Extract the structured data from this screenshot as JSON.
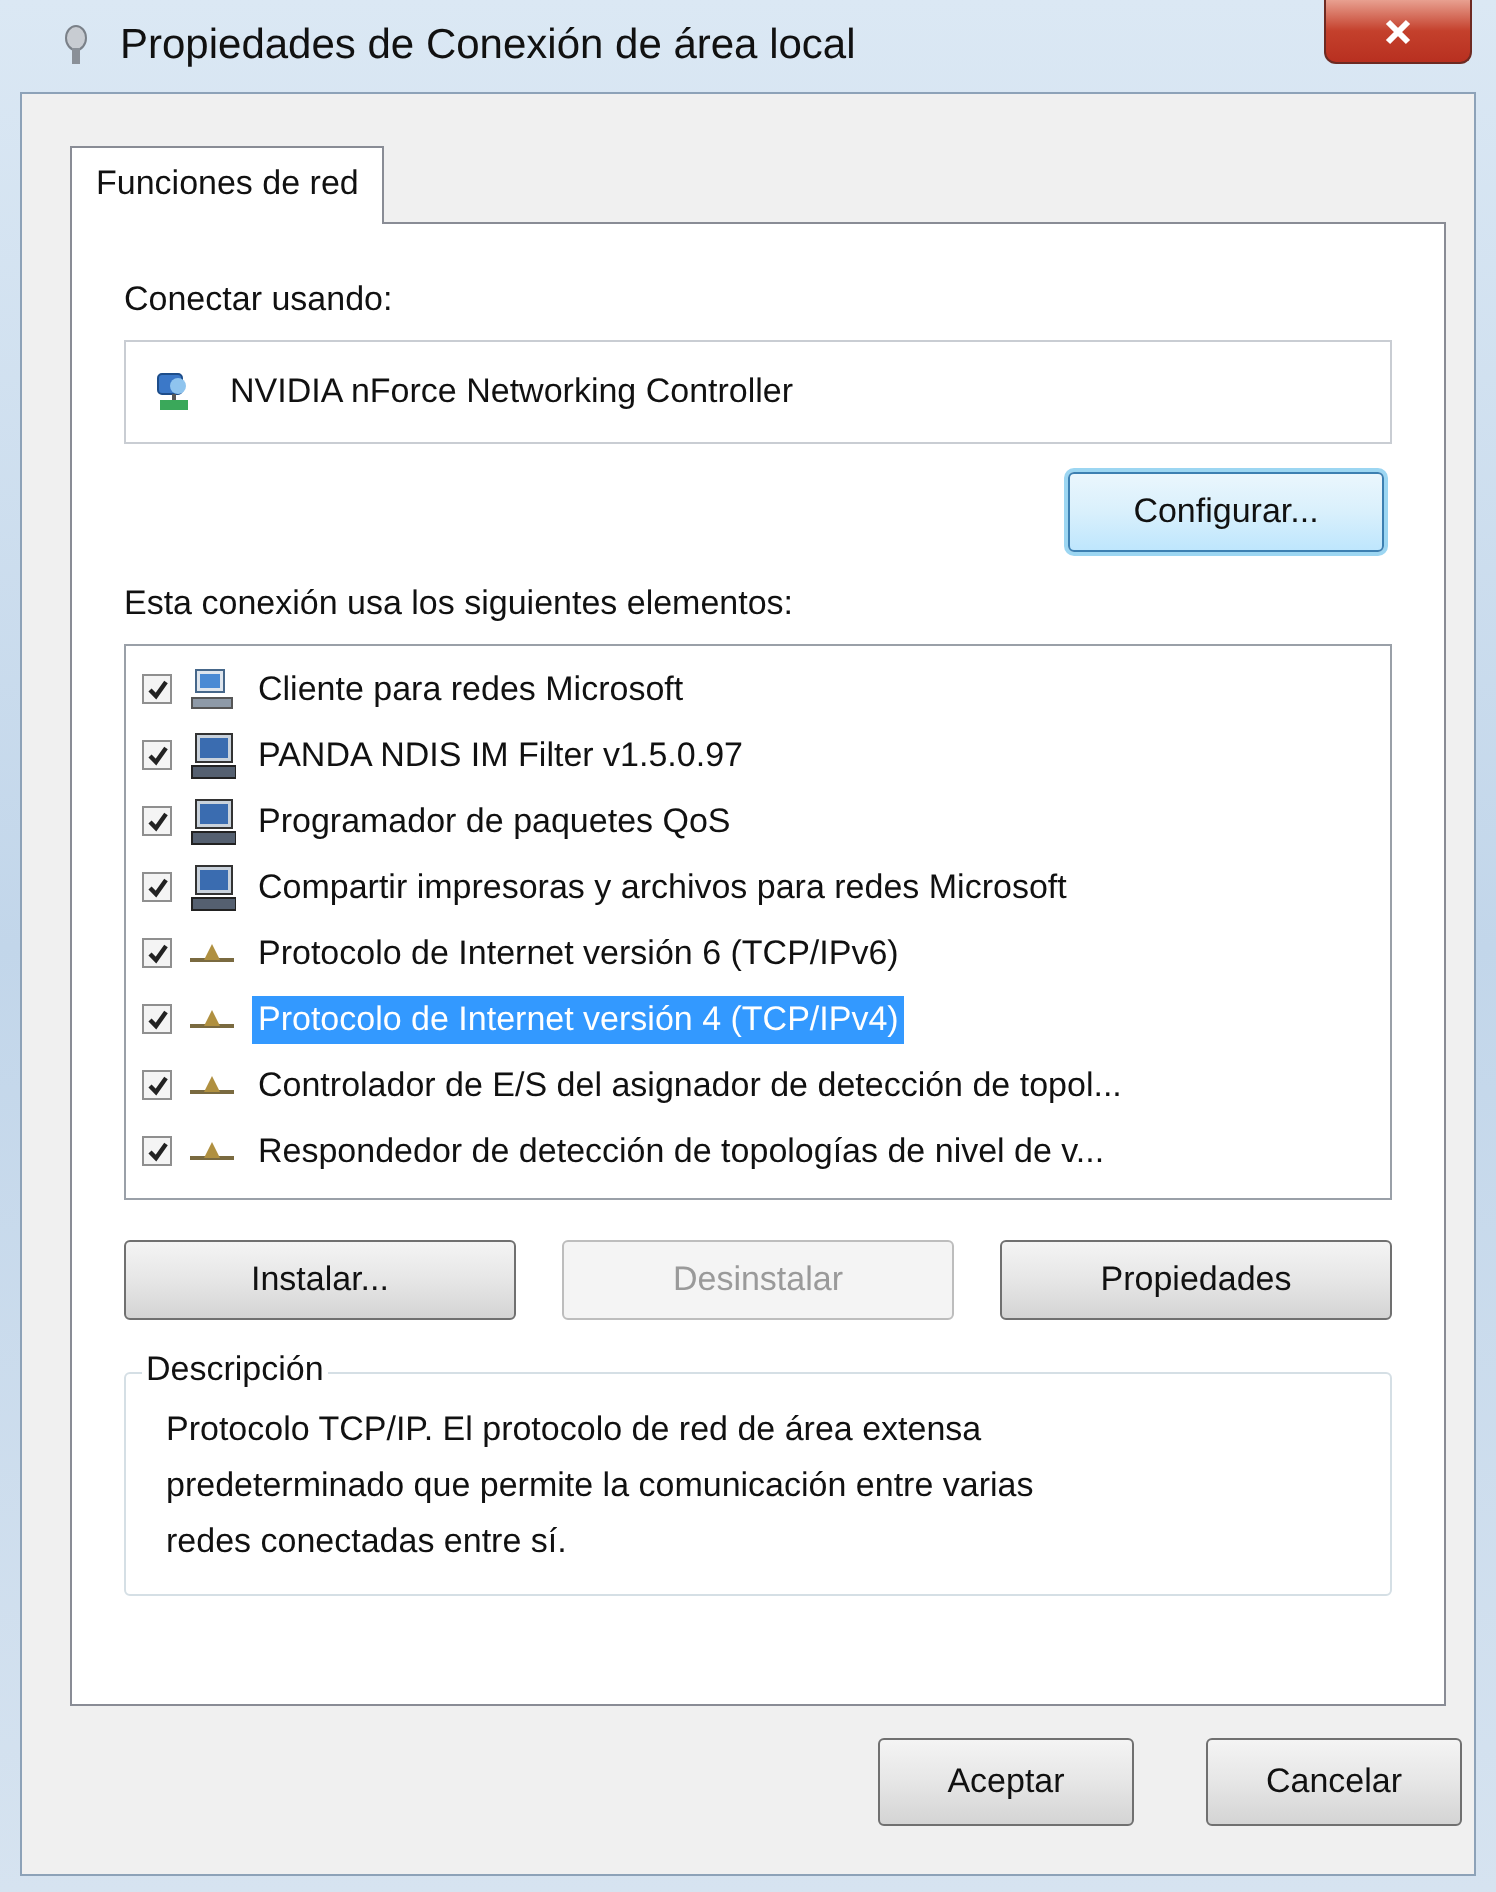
{
  "window": {
    "title": "Propiedades de Conexión de área local"
  },
  "tabs": [
    {
      "label": "Funciones de red",
      "selected": true
    }
  ],
  "connect_using": {
    "label": "Conectar usando:",
    "adapter": "NVIDIA nForce Networking Controller"
  },
  "configure_button": {
    "label": "Configurar...",
    "focused": true
  },
  "items_label": "Esta conexión usa los siguientes elementos:",
  "items": [
    {
      "kind": "client",
      "label": "Cliente para redes Microsoft",
      "checked": true,
      "selected": false
    },
    {
      "kind": "service",
      "label": "PANDA NDIS IM Filter v1.5.0.97",
      "checked": true,
      "selected": false
    },
    {
      "kind": "service",
      "label": "Programador de paquetes QoS",
      "checked": true,
      "selected": false
    },
    {
      "kind": "service",
      "label": "Compartir impresoras y archivos para redes Microsoft",
      "checked": true,
      "selected": false
    },
    {
      "kind": "protocol",
      "label": "Protocolo de Internet versión 6 (TCP/IPv6)",
      "checked": true,
      "selected": false
    },
    {
      "kind": "protocol",
      "label": "Protocolo de Internet versión 4 (TCP/IPv4)",
      "checked": true,
      "selected": true
    },
    {
      "kind": "protocol",
      "label": "Controlador de E/S del asignador de detección de topol...",
      "checked": true,
      "selected": false
    },
    {
      "kind": "protocol",
      "label": "Respondedor de detección de topologías de nivel de v...",
      "checked": true,
      "selected": false
    }
  ],
  "buttons": [
    {
      "label": "Instalar...",
      "disabled": false
    },
    {
      "label": "Desinstalar",
      "disabled": true
    },
    {
      "label": "Propiedades",
      "disabled": false
    }
  ],
  "description": {
    "label": "Descripción",
    "lines": [
      "Protocolo TCP/IP. El protocolo de red de área extensa",
      "predeterminado que permite la comunicación entre varias",
      "redes conectadas entre sí."
    ]
  },
  "dialog_buttons": [
    "Aceptar",
    "Cancelar"
  ]
}
